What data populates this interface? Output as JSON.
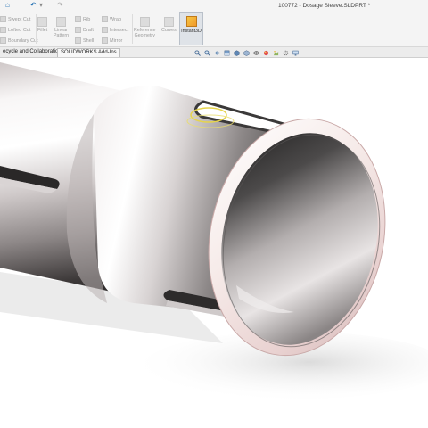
{
  "titlebar": {
    "document_title": "100772 - Dosage Sleeve.SLDPRT *",
    "quick_access": {
      "home_icon": "⌂",
      "undo_icon": "↶",
      "redo_icon": "↷",
      "dropdown_icon": "▾"
    }
  },
  "ribbon": {
    "left_stack": [
      "Swept Cut",
      "Lofted Cut",
      "Boundary Cut"
    ],
    "rib_group": [
      "Rib",
      "Draft",
      "Shell"
    ],
    "linear_pattern": "Linear\nPattern",
    "wrap_group": [
      "Wrap",
      "Intersect",
      "Mirror"
    ],
    "reference_geometry": "Reference\nGeometry",
    "curves": "Curves",
    "instant3d": "Instant3D",
    "colors": {
      "active_bg": "#dfe3e8",
      "disabled_text": "#9a9a9a"
    }
  },
  "tabs": [
    "ecycle and Collaboration",
    "SOLIDWORKS Add-Ins"
  ],
  "heads_up_toolbar": [
    "zoom-to-fit-icon",
    "zoom-area-icon",
    "previous-view-icon",
    "section-view-icon",
    "view-orientation-icon",
    "display-style-icon",
    "hide-show-icon",
    "edit-appearance-icon",
    "apply-scene-icon",
    "view-settings-icon",
    "display-icon"
  ],
  "viewport": {
    "model_name": "Dosage Sleeve",
    "background": "#ffffff"
  }
}
